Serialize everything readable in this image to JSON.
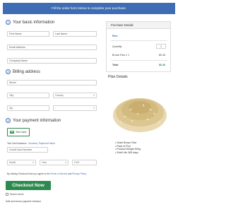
{
  "banner": "Fill the order form below to complete your purchase.",
  "basic": {
    "title": "Your basic information",
    "first_name": "First Name",
    "last_name": "Last Name",
    "email": "Email Address",
    "company": "Company Name"
  },
  "billing": {
    "title": "Billing address",
    "street": "Street",
    "city": "City",
    "country": "Country",
    "zip": "Zip",
    "state": "-"
  },
  "payment": {
    "title": "Your payment information",
    "card_option": "Test Card",
    "test_numbers_prefix": "Test Card Numbers - ",
    "test_numbers_link": "Success | Payment Failure",
    "card_number": "Credit Card Number",
    "month": "Month",
    "year": "Year",
    "cvv": "CVV"
  },
  "terms": {
    "prefix": "By clicking Checkout Now you agree to the ",
    "terms_link": "Terms of Service",
    "and": " and ",
    "privacy_link": "Privacy Policy"
  },
  "checkout_label": "Checkout Now",
  "secure_label": "Secure server",
  "safe_text": "Safe and secure payment checkout",
  "purchase": {
    "title": "Purchase Details",
    "product": "Rice",
    "quantity_label": "Quantity",
    "quantity": "1",
    "item_label": "Brown Rice x 1",
    "item_price": "$0.46",
    "total_label": "Total",
    "total": "$0.46"
  },
  "plan": {
    "title": "Plan Details",
    "features": [
      "Grain Brown Rice",
      "Pack of Five",
      "Product Weight 500g",
      "Shelf Life 365 days"
    ]
  },
  "colors": {
    "brand_blue": "#3f6db3",
    "checkout_green": "#2d8a4e"
  },
  "icons": {
    "card": "credit-card-icon",
    "rice": "rice-grains-image"
  }
}
